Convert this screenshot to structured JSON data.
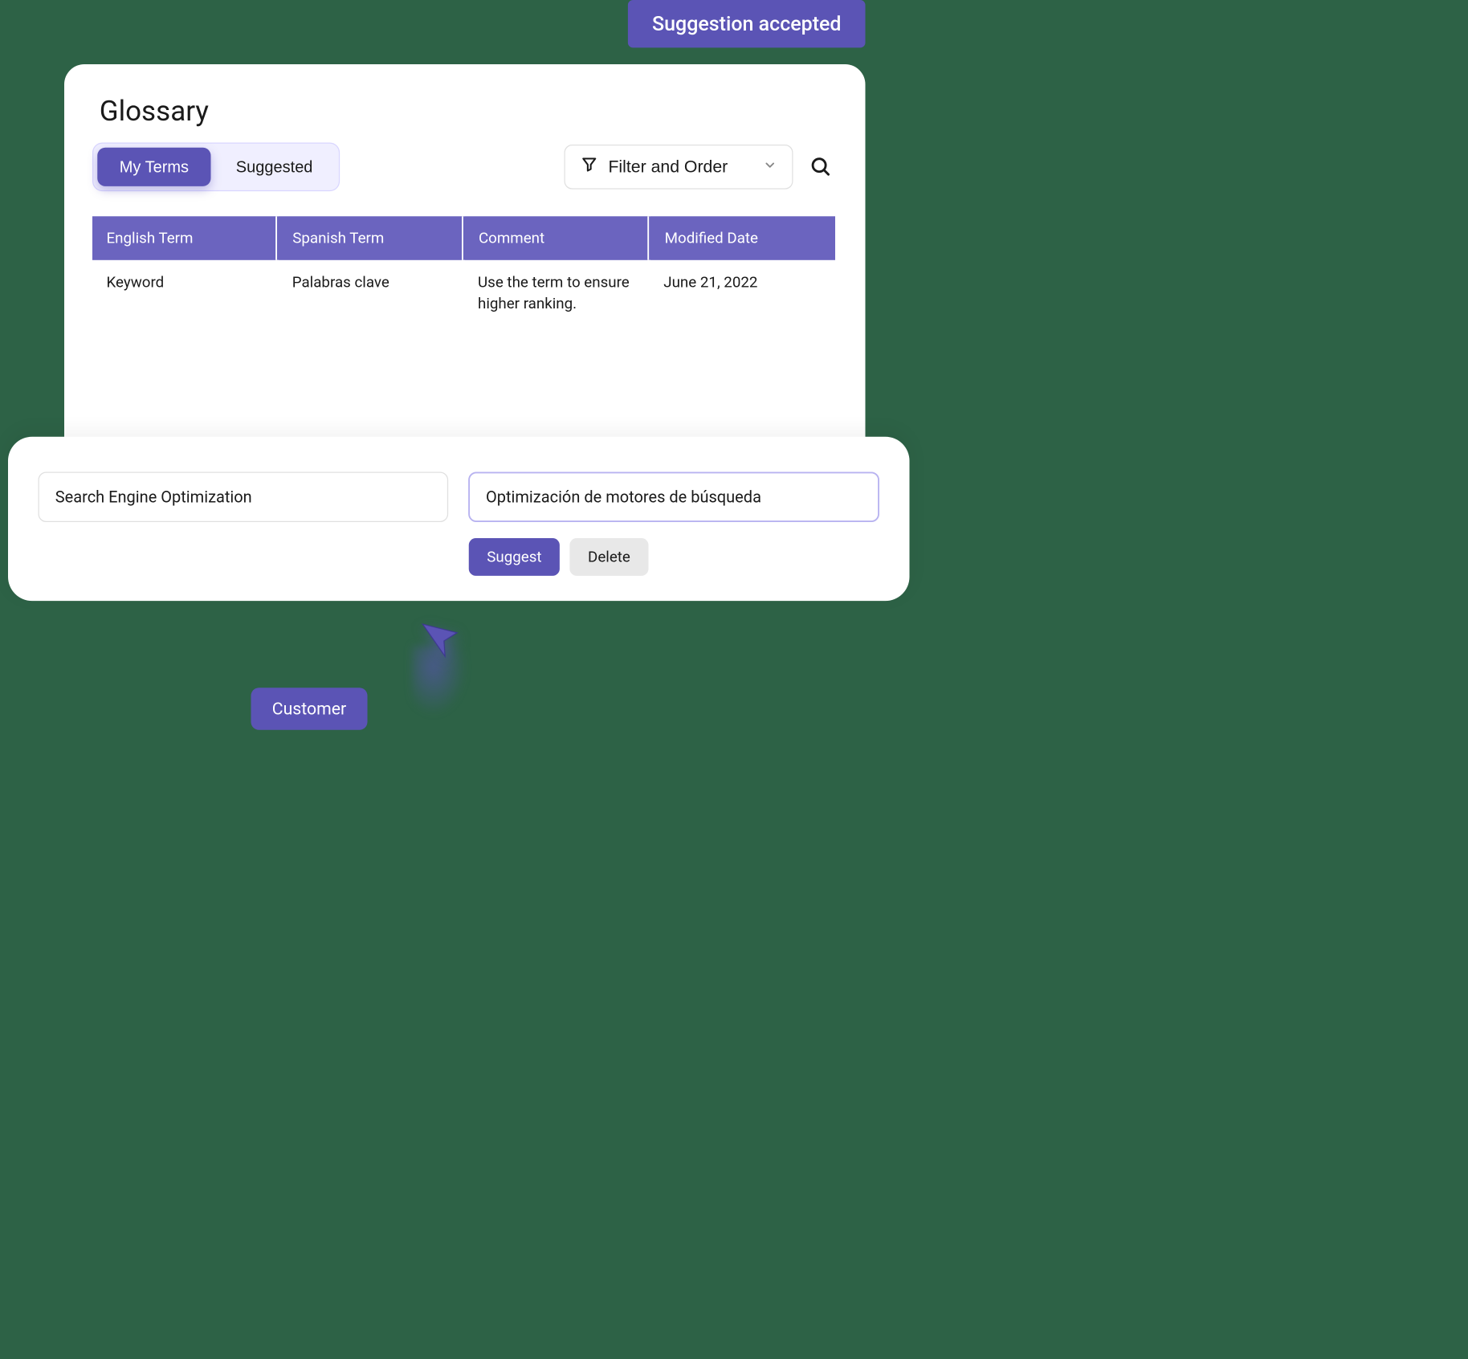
{
  "toast": {
    "message": "Suggestion accepted"
  },
  "page": {
    "title": "Glossary"
  },
  "tabs": {
    "myTerms": "My Terms",
    "suggested": "Suggested"
  },
  "filter": {
    "label": "Filter and Order"
  },
  "table": {
    "headers": {
      "english": "English Term",
      "spanish": "Spanish Term",
      "comment": "Comment",
      "modified": "Modified Date"
    },
    "rows": [
      {
        "english": "Keyword",
        "spanish": "Palabras clave",
        "comment": "Use the term to ensure higher ranking.",
        "modified": "June 21, 2022"
      }
    ]
  },
  "inputs": {
    "source": "Search Engine Optimization",
    "target": "Optimización de motores de búsqueda"
  },
  "buttons": {
    "suggest": "Suggest",
    "delete": "Delete"
  },
  "cursor": {
    "label": "Customer"
  },
  "icons": {
    "filter": "filter-icon",
    "chevronDown": "chevron-down-icon",
    "search": "search-icon"
  },
  "colors": {
    "primary": "#5B54B5",
    "headerBg": "#6B64BF",
    "background": "#2d6246"
  }
}
